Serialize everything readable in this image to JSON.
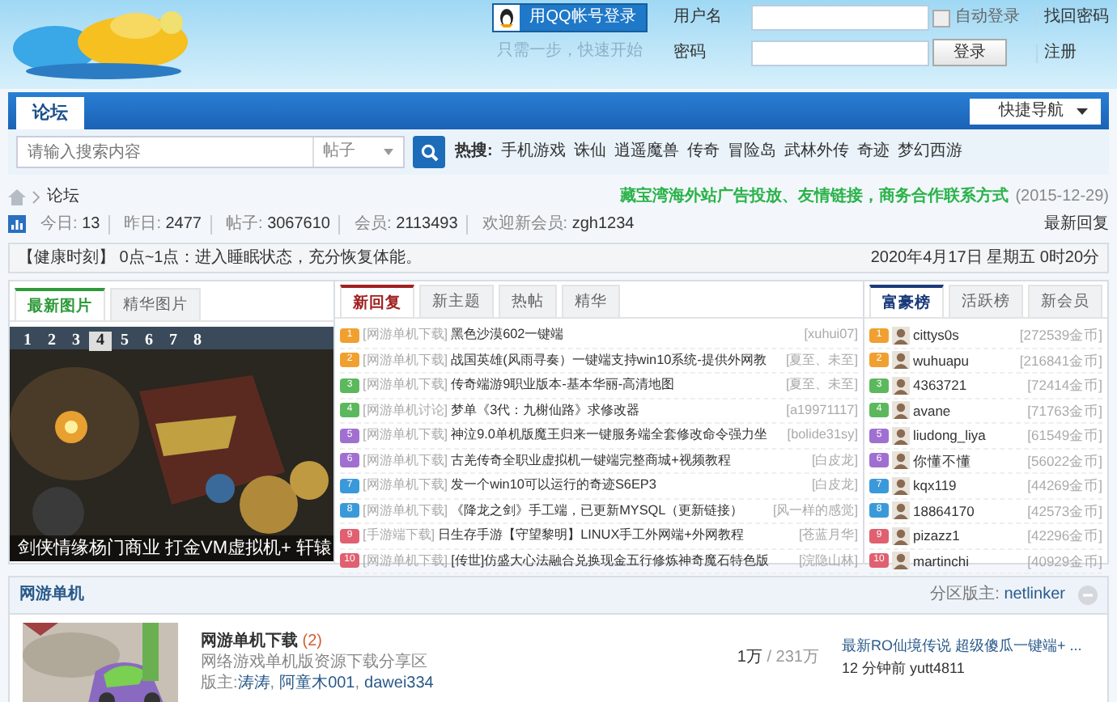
{
  "header": {
    "qq_login": "用QQ帐号登录",
    "qq_hint": "只需一步，快速开始",
    "username_label": "用户名",
    "password_label": "密码",
    "auto_login": {
      "label": "自动登录",
      "checked": false
    },
    "login_button": "登录",
    "forgot": "找回密码",
    "register": "注册"
  },
  "nav": {
    "tabs": [
      {
        "label": "论坛",
        "selected": true
      }
    ],
    "quick_nav": "快捷导航"
  },
  "search": {
    "placeholder": "请输入搜索内容",
    "scope": "帖子",
    "hot_label": "热搜:",
    "hot": [
      "手机游戏",
      "诛仙",
      "逍遥魔兽",
      "传奇",
      "冒险岛",
      "武林外传",
      "奇迹",
      "梦幻西游"
    ]
  },
  "breadcrumb": [
    "论坛"
  ],
  "notice": {
    "text": "藏宝湾海外站广告投放、友情链接，商务合作联系方式",
    "date": "(2015-12-29)"
  },
  "stats": [
    {
      "label": "今日:",
      "value": "13"
    },
    {
      "label": "昨日:",
      "value": "2477"
    },
    {
      "label": "帖子:",
      "value": "3067610"
    },
    {
      "label": "会员:",
      "value": "2113493"
    }
  ],
  "new_member": {
    "label": "欢迎新会员:",
    "name": "zgh1234"
  },
  "latest_reply": "最新回复",
  "health": {
    "text": "【健康时刻】 0点~1点：进入睡眠状态，充分恢复体能。",
    "date": "2020年4月17日 星期五 0时20分"
  },
  "pictures": {
    "tabs": [
      {
        "label": "最新图片",
        "selected": true
      },
      {
        "label": "精华图片",
        "selected": false
      }
    ],
    "pager": [
      {
        "label": "1",
        "selected": false
      },
      {
        "label": "2",
        "selected": false
      },
      {
        "label": "3",
        "selected": false
      },
      {
        "label": "4",
        "selected": true
      },
      {
        "label": "5",
        "selected": false
      },
      {
        "label": "6",
        "selected": false
      },
      {
        "label": "7",
        "selected": false
      },
      {
        "label": "8",
        "selected": false
      }
    ],
    "caption": "剑侠情缘杨门商业 打金VM虚拟机+ 轩辕"
  },
  "threads": {
    "tabs": [
      {
        "label": "新回复",
        "selected": true
      },
      {
        "label": "新主题",
        "selected": false
      },
      {
        "label": "热帖",
        "selected": false
      },
      {
        "label": "精华",
        "selected": false
      }
    ],
    "items": [
      {
        "rank": "1",
        "color": "#f0a030",
        "category": "[网游单机下载]",
        "title": "黑色沙漠602一键端",
        "author": "[xuhui07]"
      },
      {
        "rank": "2",
        "color": "#f0a030",
        "category": "[网游单机下载]",
        "title": "战国英雄(风雨寻奏）一键端支持win10系统-提供外网教",
        "author": "[夏至、未至]"
      },
      {
        "rank": "3",
        "color": "#5cb85c",
        "category": "[网游单机下载]",
        "title": "传奇端游9职业版本-基本华丽-高清地图",
        "author": "[夏至、未至]"
      },
      {
        "rank": "4",
        "color": "#5cb85c",
        "category": "[网游单机讨论]",
        "title": "梦单《3代：九榭仙路》求修改器",
        "author": "[a19971117]"
      },
      {
        "rank": "5",
        "color": "#a070d0",
        "category": "[网游单机下载]",
        "title": "神泣9.0单机版魔王归来一键服务端全套修改命令强力坐",
        "author": "[bolide31sy]"
      },
      {
        "rank": "6",
        "color": "#a070d0",
        "category": "[网游单机下载]",
        "title": "古羌传奇全职业虚拟机一键端完整商城+视频教程",
        "author": "[白皮龙]"
      },
      {
        "rank": "7",
        "color": "#3a9ad9",
        "category": "[网游单机下载]",
        "title": "发一个win10可以运行的奇迹S6EP3",
        "author": "[白皮龙]"
      },
      {
        "rank": "8",
        "color": "#3a9ad9",
        "category": "[网游单机下载]",
        "title": "《降龙之剑》手工端，已更新MYSQL（更新链接）",
        "author": "[风一样的感觉]"
      },
      {
        "rank": "9",
        "color": "#e06070",
        "category": "[手游端下载]",
        "title": "日生存手游【守望黎明】LINUX手工外网端+外网教程",
        "author": "[苍蓝月华]"
      },
      {
        "rank": "10",
        "color": "#e06070",
        "category": "[网游单机下载]",
        "title": "[传世]仿盛大心法融合兑换现金五行修炼神奇魔石特色版",
        "author": "[浣隐山林]"
      }
    ]
  },
  "rich": {
    "tabs": [
      {
        "label": "富豪榜",
        "selected": true
      },
      {
        "label": "活跃榜",
        "selected": false
      },
      {
        "label": "新会员",
        "selected": false
      }
    ],
    "items": [
      {
        "rank": "1",
        "color": "#f0a030",
        "name": "cittys0s",
        "coins": "[272539金币]"
      },
      {
        "rank": "2",
        "color": "#f0a030",
        "name": "wuhuapu",
        "coins": "[216841金币]"
      },
      {
        "rank": "3",
        "color": "#5cb85c",
        "name": "4363721",
        "coins": "[72414金币]"
      },
      {
        "rank": "4",
        "color": "#5cb85c",
        "name": "avane",
        "coins": "[71763金币]"
      },
      {
        "rank": "5",
        "color": "#a070d0",
        "name": "liudong_liya",
        "coins": "[61549金币]"
      },
      {
        "rank": "6",
        "color": "#a070d0",
        "name": "你懂不懂",
        "coins": "[56022金币]"
      },
      {
        "rank": "7",
        "color": "#3a9ad9",
        "name": "kqx119",
        "coins": "[44269金币]"
      },
      {
        "rank": "8",
        "color": "#3a9ad9",
        "name": "18864170",
        "coins": "[42573金币]"
      },
      {
        "rank": "9",
        "color": "#e06070",
        "name": "pizazz1",
        "coins": "[42296金币]"
      },
      {
        "rank": "10",
        "color": "#e06070",
        "name": "martinchi",
        "coins": "[40929金币]"
      }
    ]
  },
  "section": {
    "title": "网游单机",
    "moderator_label": "分区版主:",
    "moderator": "netlinker"
  },
  "forums": [
    {
      "name": "网游单机下载",
      "count": "(2)",
      "description": "网络游戏单机版资源下载分享区",
      "moderators_label": "版主:",
      "moderators": [
        "涛涛",
        "阿童木001",
        "dawei334"
      ],
      "moderator_separator": ",",
      "threads": "1万",
      "posts": "/ 231万",
      "last_post": "最新RO仙境传说 超级傻瓜一键端+ ...",
      "last_info": "12 分钟前 yutt4811"
    }
  ]
}
